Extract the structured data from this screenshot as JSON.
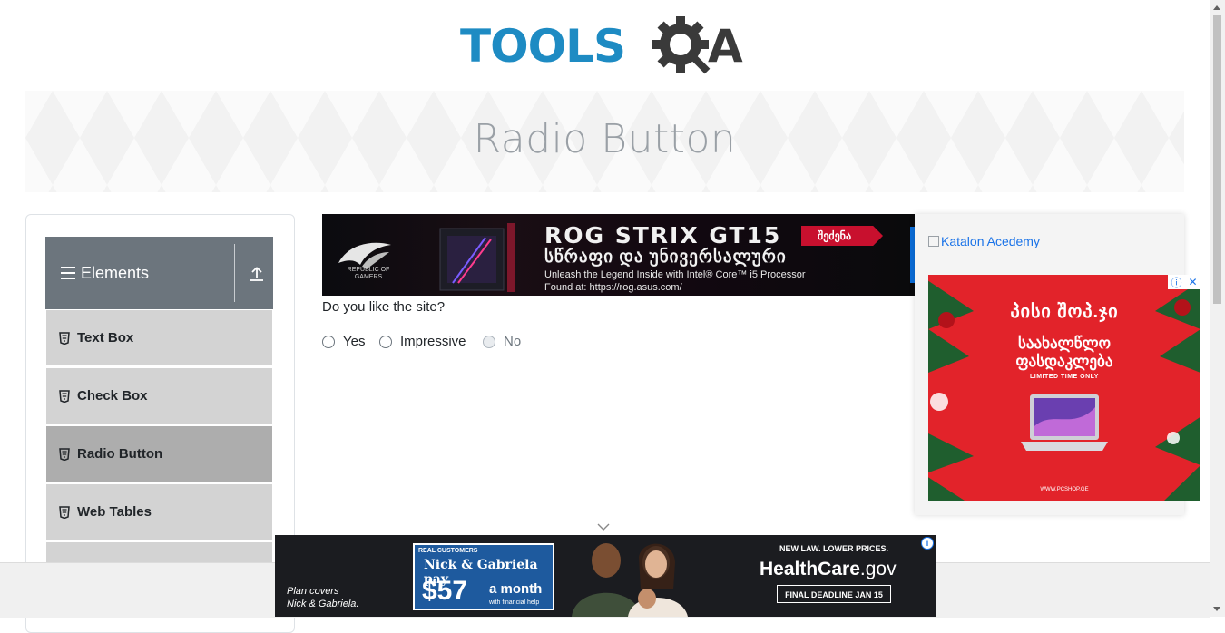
{
  "header": {
    "logo_text": "TOOLSQA"
  },
  "banner": {
    "title": "Radio Button"
  },
  "sidebar": {
    "group": {
      "label": "Elements"
    },
    "items": [
      {
        "label": "Text Box"
      },
      {
        "label": "Check Box"
      },
      {
        "label": "Radio Button",
        "active": true
      },
      {
        "label": "Web Tables"
      }
    ]
  },
  "top_ad": {
    "brand": "REPUBLIC OF GAMERS",
    "title": "ROG STRIX GT15",
    "subtitle_geo": "სწრაფი და უნივერსალური",
    "line1": "Unleash the Legend Inside with Intel® Core™ i5 Processor",
    "line2": "Found at: https://rog.asus.com/",
    "button": "შეძენა"
  },
  "form": {
    "question": "Do you like the site?",
    "options": [
      {
        "label": "Yes",
        "disabled": false
      },
      {
        "label": "Impressive",
        "disabled": false
      },
      {
        "label": "No",
        "disabled": true
      }
    ]
  },
  "right_column": {
    "link_text": "Katalon Acedemy",
    "side_ad": {
      "brand": "პისი შოპ.ჯი",
      "headline_line1": "საახალწლო",
      "headline_line2": "ფასდაკლება",
      "limited": "LIMITED TIME ONLY",
      "site": "WWW.PCSHOP.GE"
    }
  },
  "bottom_ad": {
    "plan_line1": "Plan covers",
    "plan_line2": "Nick & Gabriela.",
    "real_customers": "REAL CUSTOMERS",
    "names": "Nick & Gabriela pay",
    "amount": "$57",
    "per_month": "a month",
    "financial_help": "with financial help",
    "new_law": "NEW LAW. LOWER PRICES.",
    "site_main": "HealthCare",
    "site_tld": ".gov",
    "deadline": "FINAL DEADLINE JAN 15"
  },
  "colors": {
    "logo_blue": "#1e8bc3",
    "logo_dark": "#3a3a3a",
    "sidebar_header": "#6c757d",
    "sidebar_item": "#d3d3d3",
    "sidebar_item_active": "#adadad",
    "link": "#1a73e8",
    "side_ad_red": "#e2232a"
  }
}
